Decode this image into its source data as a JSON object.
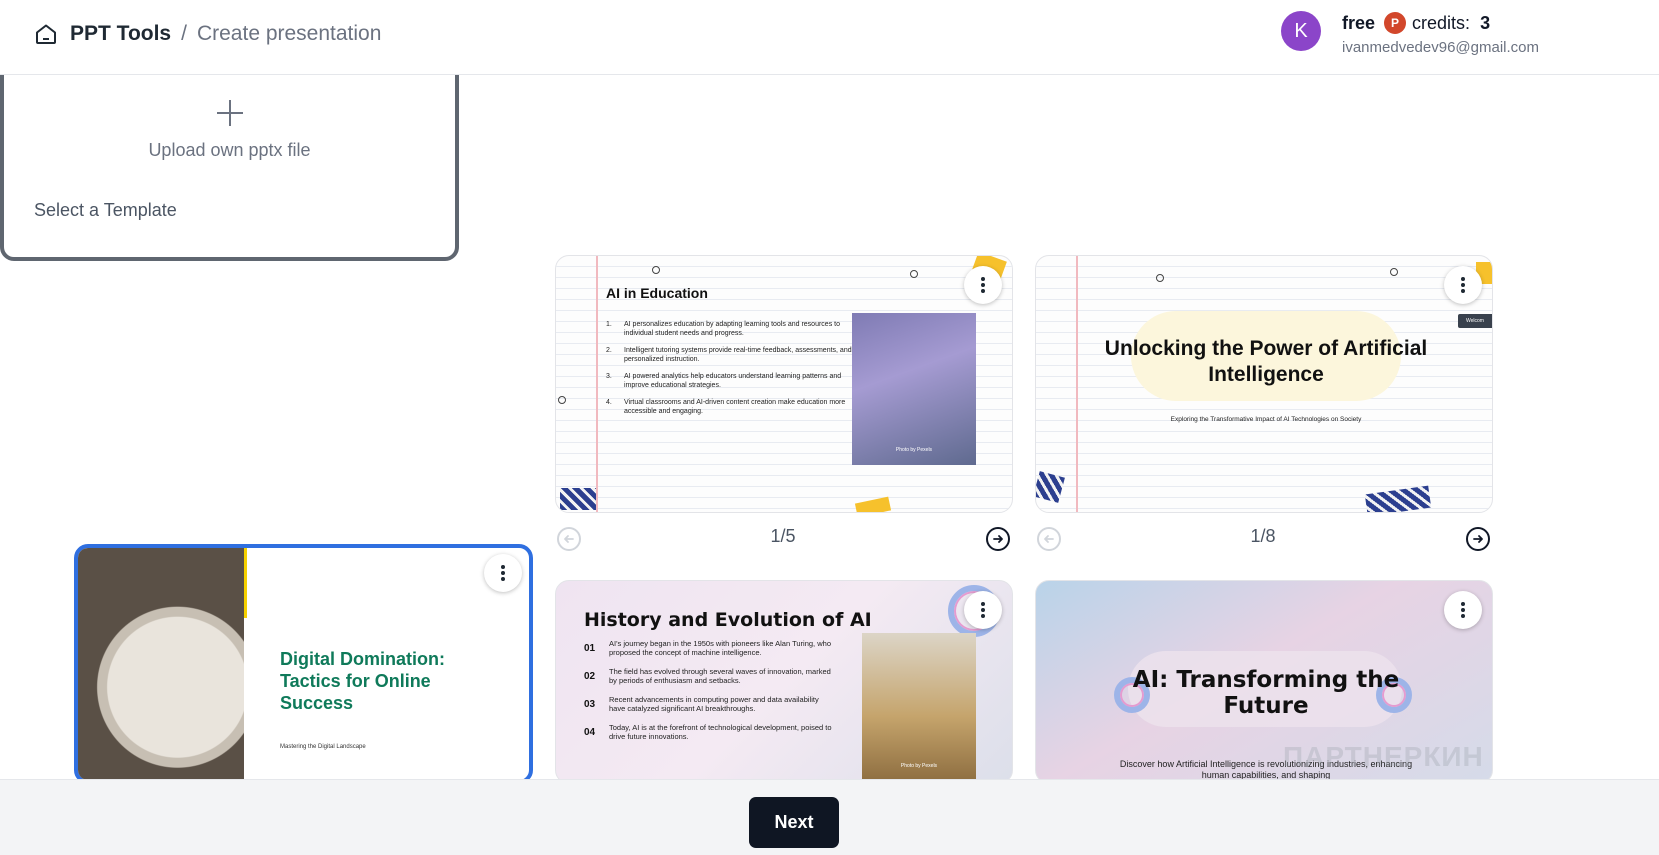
{
  "header": {
    "brand": "PPT Tools",
    "separator": "/",
    "current_page": "Create presentation"
  },
  "user": {
    "avatar_letter": "K",
    "plan": "free",
    "credits_label": "credits:",
    "credits_value": "3",
    "email": "ivanmedvedev96@gmail.com"
  },
  "section": {
    "title": "Select a Template"
  },
  "upload": {
    "label": "Upload own pptx file"
  },
  "templates": [
    {
      "title": "AI in Education",
      "points": [
        {
          "n": "1.",
          "text": "AI personalizes education by adapting learning tools and resources to individual student needs and progress."
        },
        {
          "n": "2.",
          "text": "Intelligent tutoring systems provide real-time feedback, assessments, and personalized instruction."
        },
        {
          "n": "3.",
          "text": "AI powered analytics help educators understand learning patterns and improve educational strategies."
        },
        {
          "n": "4.",
          "text": "Virtual classrooms and AI-driven content creation make education more accessible and engaging."
        }
      ],
      "photo_caption": "Photo by Pexels",
      "pager": "1/5"
    },
    {
      "title": "Unlocking the Power of Artificial Intelligence",
      "subtitle": "Exploring the Transformative Impact of AI Technologies on Society",
      "tag": "Welcom",
      "pager": "1/8"
    },
    {
      "title": "Digital Domination: Tactics for Online Success",
      "subtitle": "Mastering the Digital Landscape",
      "selected": true
    },
    {
      "title": "History and Evolution of AI",
      "points": [
        {
          "n": "01",
          "text": "AI's journey began in the 1950s with pioneers like Alan Turing, who proposed the concept of machine intelligence."
        },
        {
          "n": "02",
          "text": "The field has evolved through several waves of innovation, marked by periods of enthusiasm and setbacks."
        },
        {
          "n": "03",
          "text": "Recent advancements in computing power and data availability have catalyzed significant AI breakthroughs."
        },
        {
          "n": "04",
          "text": "Today, AI is at the forefront of technological development, poised to drive future innovations."
        }
      ],
      "photo_caption": "Photo by Pexels"
    },
    {
      "title": "AI: Transforming the Future",
      "subtitle": "Discover how Artificial Intelligence is revolutionizing industries, enhancing human capabilities, and shaping"
    }
  ],
  "watermark": "ПАРТНЕРКИН",
  "footer": {
    "next_label": "Next"
  },
  "colors": {
    "accent_selected": "#2f6fe0",
    "avatar": "#8b45c9",
    "next_button": "#0f1623",
    "ppt_icon": "#d2472b"
  }
}
